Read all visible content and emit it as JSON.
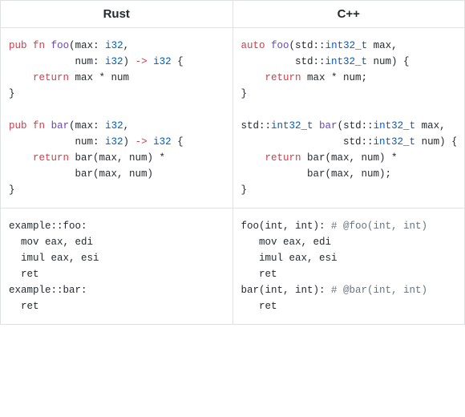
{
  "headers": {
    "rust": "Rust",
    "cpp": "C++"
  },
  "rust_src": {
    "l1_kw_pub": "pub",
    "l1_kw_fn": "fn",
    "l1_name": "foo",
    "l1_open": "(max: ",
    "l1_ty1": "i32",
    "l1_end": ",",
    "l2_sp": "           ",
    "l2_txt": "num: ",
    "l2_ty": "i32",
    "l2_arrow_a": ") ",
    "l2_arrow_sym": "->",
    "l2_arrow_b": " ",
    "l2_ret_ty": "i32",
    "l2_brace": " {",
    "l3_sp": "    ",
    "l3_kw": "return",
    "l3_txt": " max * num",
    "l4": "}",
    "blank": "",
    "l5_kw_pub": "pub",
    "l5_kw_fn": "fn",
    "l5_name": "bar",
    "l5_open": "(max: ",
    "l5_ty1": "i32",
    "l5_end": ",",
    "l6_sp": "           ",
    "l6_txt": "num: ",
    "l6_ty": "i32",
    "l6_arrow_a": ") ",
    "l6_arrow_sym": "->",
    "l6_arrow_b": " ",
    "l6_ret_ty": "i32",
    "l6_brace": " {",
    "l7_sp": "    ",
    "l7_kw": "return",
    "l7_txt": " bar(max, num) *",
    "l8_sp": "           ",
    "l8_txt": "bar(max, num)",
    "l9": "}"
  },
  "cpp_src": {
    "l1_kw": "auto",
    "l1_sp": " ",
    "l1_name": "foo",
    "l1_open": "(std::",
    "l1_ty": "int32_t",
    "l1_txt": " max,",
    "l2_sp": "         ",
    "l2_a": "std::",
    "l2_ty": "int32_t",
    "l2_txt": " num) {",
    "l3_sp": "    ",
    "l3_kw": "return",
    "l3_txt": " max * num;",
    "l4": "}",
    "blank": "",
    "l5_a": "std::",
    "l5_ty": "int32_t",
    "l5_sp": " ",
    "l5_name": "bar",
    "l5_open": "(std::",
    "l5_ty2": "int32_t",
    "l5_txt": " max,",
    "l6_sp": "                 ",
    "l6_a": "std::",
    "l6_ty": "int32_t",
    "l6_txt": " num) {",
    "l7_sp": "    ",
    "l7_kw": "return",
    "l7_txt": " bar(max, num) *",
    "l8_sp": "           ",
    "l8_txt": "bar(max, num);",
    "l9": "}"
  },
  "rust_asm": {
    "l1": "example::foo:",
    "l2": "  mov eax, edi",
    "l3": "  imul eax, esi",
    "l4": "  ret",
    "l5": "example::bar:",
    "l6": "  ret"
  },
  "cpp_asm": {
    "l1a": "foo(int, int): ",
    "l1b": "# @foo(int, int)",
    "l2": "   mov eax, edi",
    "l3": "   imul eax, esi",
    "l4": "   ret",
    "l5a": "bar(int, int): ",
    "l5b": "# @bar(int, int)",
    "l6": "   ret"
  }
}
